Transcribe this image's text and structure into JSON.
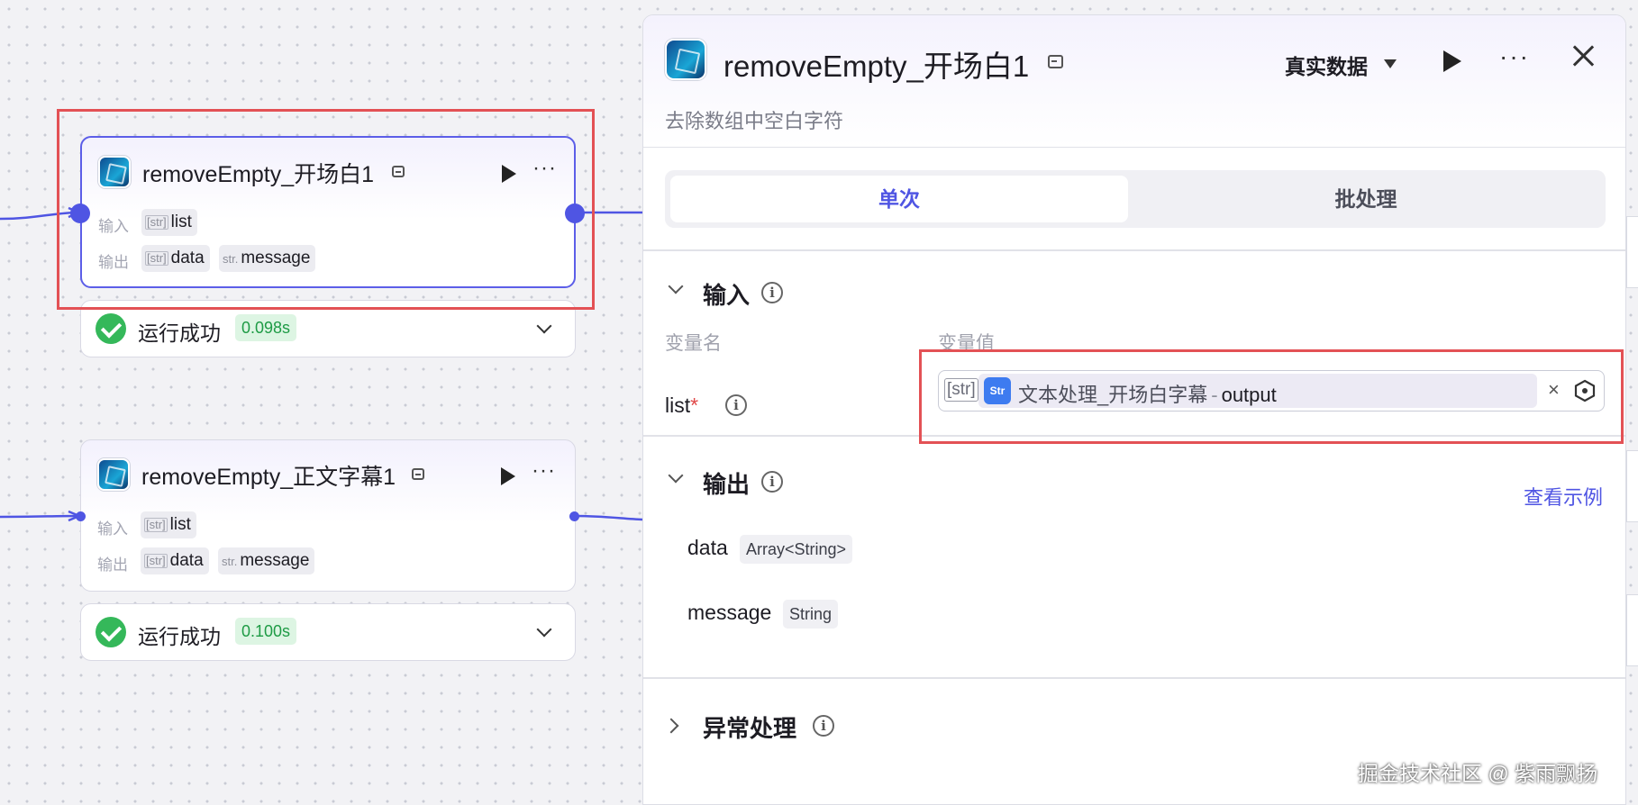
{
  "canvas": {
    "nodes": [
      {
        "title": "removeEmpty_开场白1",
        "input_label": "输入",
        "output_label": "输出",
        "inputs": [
          {
            "type": "[str]",
            "name": "list"
          }
        ],
        "outputs": [
          {
            "type": "[str]",
            "name": "data"
          },
          {
            "type": "str.",
            "name": "message"
          }
        ],
        "status": "运行成功",
        "duration": "0.098s"
      },
      {
        "title": "removeEmpty_正文字幕1",
        "input_label": "输入",
        "output_label": "输出",
        "inputs": [
          {
            "type": "[str]",
            "name": "list"
          }
        ],
        "outputs": [
          {
            "type": "[str]",
            "name": "data"
          },
          {
            "type": "str.",
            "name": "message"
          }
        ],
        "status": "运行成功",
        "duration": "0.100s"
      }
    ]
  },
  "panel": {
    "title": "removeEmpty_开场白1",
    "description": "去除数组中空白字符",
    "data_mode": "真实数据",
    "tabs": [
      {
        "label": "单次",
        "active": true
      },
      {
        "label": "批处理",
        "active": false
      }
    ],
    "input_section": {
      "title": "输入",
      "col_name": "变量名",
      "col_value": "变量值",
      "var_name": "list",
      "required_mark": "*",
      "value_type": "[str]",
      "plugin_badge": "Str",
      "ref_node": "文本处理_开场白字幕",
      "ref_separator": "-",
      "ref_var": "output"
    },
    "output_section": {
      "title": "输出",
      "example_link": "查看示例",
      "outputs": [
        {
          "name": "data",
          "type": "Array<String>"
        },
        {
          "name": "message",
          "type": "String"
        }
      ]
    },
    "error_section": {
      "title": "异常处理"
    }
  },
  "colors": {
    "accent": "#4f55e3",
    "success": "#35b85a",
    "highlight_box": "#e35155"
  },
  "watermark": "掘金技术社区 @ 紫雨飘扬"
}
